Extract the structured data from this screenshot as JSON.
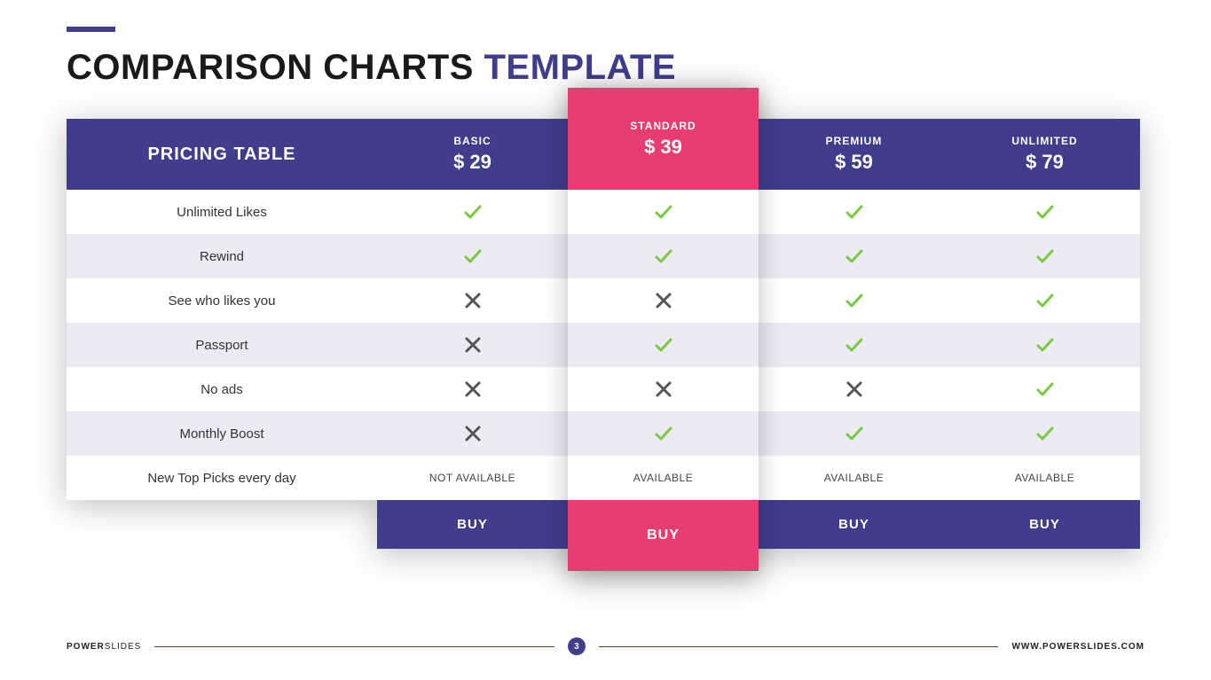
{
  "title": {
    "part1": "COMPARISON CHARTS",
    "part2": "TEMPLATE"
  },
  "table_heading": "PRICING TABLE",
  "plans": [
    {
      "name": "BASIC",
      "price": "$ 29",
      "buy": "BUY"
    },
    {
      "name": "STANDARD",
      "price": "$ 39",
      "buy": "BUY"
    },
    {
      "name": "PREMIUM",
      "price": "$ 59",
      "buy": "BUY"
    },
    {
      "name": "UNLIMITED",
      "price": "$ 79",
      "buy": "BUY"
    }
  ],
  "features": [
    "Unlimited Likes",
    "Rewind",
    "See who likes you",
    "Passport",
    "No ads",
    "Monthly Boost",
    "New Top Picks every day"
  ],
  "availability": {
    "not_available": "NOT AVAILABLE",
    "available": "AVAILABLE"
  },
  "footer": {
    "brand1": "POWER",
    "brand2": "SLIDES",
    "page": "3",
    "url": "WWW.POWERSLIDES.COM"
  },
  "chart_data": {
    "type": "table",
    "title": "Pricing Table",
    "columns": [
      "BASIC $29",
      "STANDARD $39",
      "PREMIUM $59",
      "UNLIMITED $79"
    ],
    "rows": [
      {
        "feature": "Unlimited Likes",
        "values": [
          true,
          true,
          true,
          true
        ]
      },
      {
        "feature": "Rewind",
        "values": [
          true,
          true,
          true,
          true
        ]
      },
      {
        "feature": "See who likes you",
        "values": [
          false,
          false,
          true,
          true
        ]
      },
      {
        "feature": "Passport",
        "values": [
          false,
          true,
          true,
          true
        ]
      },
      {
        "feature": "No ads",
        "values": [
          false,
          false,
          false,
          true
        ]
      },
      {
        "feature": "Monthly Boost",
        "values": [
          false,
          true,
          true,
          true
        ]
      },
      {
        "feature": "New Top Picks every day",
        "values": [
          "NOT AVAILABLE",
          "AVAILABLE",
          "AVAILABLE",
          "AVAILABLE"
        ]
      }
    ]
  }
}
